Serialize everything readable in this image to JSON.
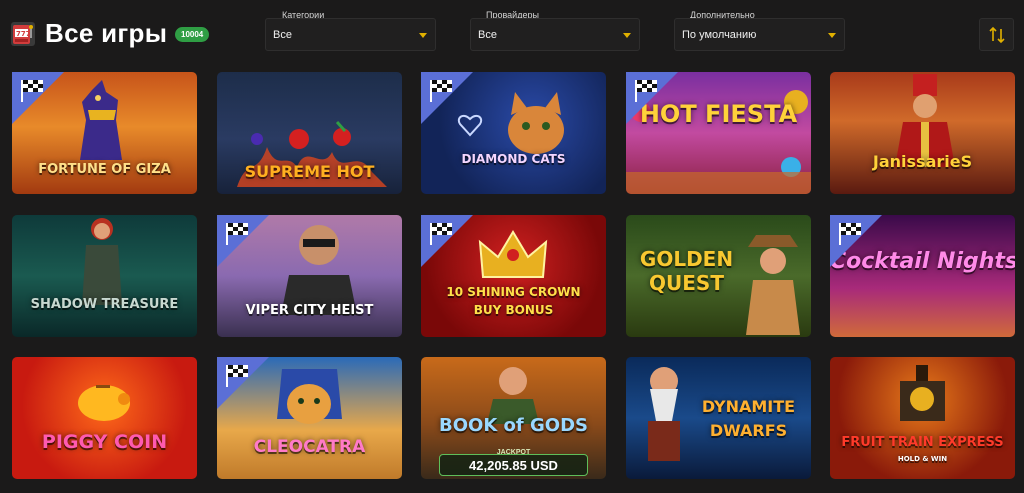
{
  "header": {
    "title": "Все игры",
    "count": "10004",
    "filters": [
      {
        "label": "Категории",
        "value": "Все"
      },
      {
        "label": "Провайдеры",
        "value": "Все"
      },
      {
        "label": "Дополнительно",
        "value": "По умолчанию"
      }
    ],
    "sort_icon": "sort-arrows-icon"
  },
  "games": [
    {
      "title": "FORTUNE OF GIZA",
      "flag": true
    },
    {
      "title": "SUPREME HOT",
      "flag": false
    },
    {
      "title": "DIAMOND CATS",
      "flag": true
    },
    {
      "title": "HOT FIESTA",
      "flag": true
    },
    {
      "title": "JanissarieS",
      "flag": false
    },
    {
      "title": "SHADOW TREASURE",
      "flag": false
    },
    {
      "title": "VIPER CITY HEIST",
      "flag": true
    },
    {
      "title": "10 SHINING CROWN",
      "subtitle": "BUY BONUS",
      "flag": true
    },
    {
      "title": "GOLDEN QUEST",
      "flag": false
    },
    {
      "title": "Cocktail Nights",
      "flag": true
    },
    {
      "title": "PIGGY COIN",
      "flag": false
    },
    {
      "title": "CLEOCATRA",
      "flag": true
    },
    {
      "title": "BOOK of GODS",
      "jackpot_label": "JACKPOT",
      "jackpot_value": "42,205.85 USD",
      "flag": false
    },
    {
      "title": "DYNAMITE DWARFS",
      "flag": false
    },
    {
      "title": "FRUIT TRAIN EXPRESS",
      "subtitle": "HOLD & WIN",
      "flag": false
    }
  ],
  "colors": {
    "background": "#1b1a1a",
    "accent": "#e0b000",
    "badge": "#2f9e44",
    "flag": "#5b6fd6"
  }
}
